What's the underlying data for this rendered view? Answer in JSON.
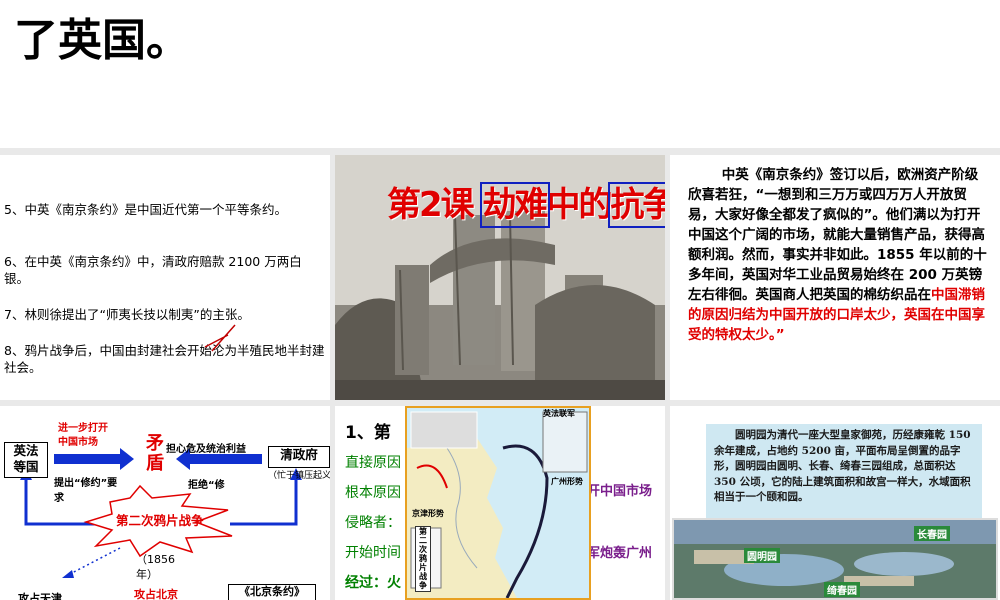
{
  "top": {
    "title": "了英国。"
  },
  "slide1": {
    "items": [
      "5、中英《南京条约》是中国近代第一个平等条约。",
      "6、在中英《南京条约》中，清政府赔款 2100 万两白银。",
      "7、林则徐提出了“师夷长技以制夷”的主张。",
      "8、鸦片战争后，中国由封建社会开始沦为半殖民地半封建社会。"
    ]
  },
  "slide2": {
    "title_parts": [
      "第2课 ",
      "劫难",
      "中的",
      "抗争"
    ]
  },
  "slide3": {
    "text_black": "中英《南京条约》签订以后，欧洲资产阶级欣喜若狂，“一想到和三万万或四万万人开放贸易，大家好像全都发了疯似的”。他们满以为打开中国这个广阔的市场，就能大量销售产品，获得高额利润。然而，事实并非如此。1855 年以前的十多年间，英国对华工业品贸易始终在 200 万英镑左右徘徊。英国商人把英国的棉纺织品在",
    "text_red": "中国滞销的原因归结为中国开放的口岸太少，英国在中国享受的特权太少。”"
  },
  "slide4": {
    "left_box": "英法\n等国",
    "right_box": "清政府",
    "right_note": "（忙于镇压起义）",
    "top_left_label": "进一步打开\n中国市场",
    "top_right_label": "担心危及统治利益",
    "center": "矛\n盾",
    "mid_left": "提出“修约”要\n求",
    "mid_right": "拒绝“修",
    "war": "第二次鸦片战争",
    "year": "（1856\n年）",
    "bottom_left": "攻占天津",
    "bottom_mid": "攻占北京",
    "bottom_right": "《北京条约》"
  },
  "slide5": {
    "heading": "1、第",
    "lines": [
      "直接原因",
      "根本原因",
      "侵略者：",
      "开始时间",
      "经过：火"
    ],
    "right_1": "开中国市场",
    "right_2": "军炮轰广州",
    "map_vertical": "第二次鸦片战争",
    "map_tag_top": "英法联军",
    "map_tag_left": "京津形势",
    "map_tag_bottom": "广州形势"
  },
  "slide6": {
    "text": "圆明园为清代一座大型皇家御苑，历经康雍乾 150 余年建成，占地约 5200 亩，平面布局呈倒置的品字形，圆明园由圆明、长春、绮春三园组成，总面积达 350 公顷，它的陆上建筑面积和故宫一样大，水域面积相当于一个颐和园。",
    "photo_labels": [
      "长春园",
      "圆明园",
      "绮春园"
    ]
  },
  "colors": {
    "accent_red": "#e00000",
    "title_blue": "#1020c0",
    "arrow_blue": "#1030d0"
  }
}
